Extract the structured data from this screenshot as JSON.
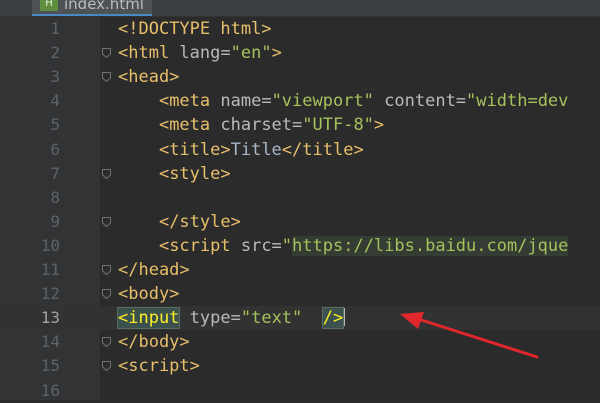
{
  "editor_tab": {
    "icon": "html-file-icon",
    "icon_text": "H",
    "filename": "index.html"
  },
  "colors": {
    "tag": "#e8bf6a",
    "attribute": "#bababa",
    "string": "#a5c25c",
    "text": "#a9b7c6",
    "background": "#2b2b2b",
    "arrow": "#e0282c"
  },
  "current_line": 13,
  "annotation": {
    "type": "red-arrow-pointing-at-line-13"
  },
  "lines": [
    {
      "number": "1",
      "fold": false,
      "tokens": [
        {
          "cls": "tg",
          "text": "<!DOCTYPE html>"
        }
      ]
    },
    {
      "number": "2",
      "fold": true,
      "tokens": [
        {
          "cls": "tg",
          "text": "<html "
        },
        {
          "cls": "at",
          "text": "lang="
        },
        {
          "cls": "st",
          "text": "\"en\""
        },
        {
          "cls": "tg",
          "text": ">"
        }
      ]
    },
    {
      "number": "3",
      "fold": true,
      "tokens": [
        {
          "cls": "tg",
          "text": "<head>"
        }
      ]
    },
    {
      "number": "4",
      "fold": false,
      "tokens": [
        {
          "cls": "tx",
          "text": "    "
        },
        {
          "cls": "tg",
          "text": "<meta "
        },
        {
          "cls": "at",
          "text": "name="
        },
        {
          "cls": "st",
          "text": "\"viewport\" "
        },
        {
          "cls": "at",
          "text": "content="
        },
        {
          "cls": "st",
          "text": "\"width=dev"
        }
      ]
    },
    {
      "number": "5",
      "fold": false,
      "tokens": [
        {
          "cls": "tx",
          "text": "    "
        },
        {
          "cls": "tg",
          "text": "<meta "
        },
        {
          "cls": "at",
          "text": "charset="
        },
        {
          "cls": "st",
          "text": "\"UTF-8\""
        },
        {
          "cls": "tg",
          "text": ">"
        }
      ]
    },
    {
      "number": "6",
      "fold": false,
      "tokens": [
        {
          "cls": "tx",
          "text": "    "
        },
        {
          "cls": "tg",
          "text": "<title>"
        },
        {
          "cls": "tx",
          "text": "Title"
        },
        {
          "cls": "tg",
          "text": "</title>"
        }
      ]
    },
    {
      "number": "7",
      "fold": true,
      "tokens": [
        {
          "cls": "tx",
          "text": "    "
        },
        {
          "cls": "tg",
          "text": "<style>"
        }
      ]
    },
    {
      "number": "8",
      "fold": false,
      "tokens": []
    },
    {
      "number": "9",
      "fold": true,
      "tokens": [
        {
          "cls": "tx",
          "text": "    "
        },
        {
          "cls": "tg",
          "text": "</style>"
        }
      ]
    },
    {
      "number": "10",
      "fold": false,
      "tokens": [
        {
          "cls": "tx",
          "text": "    "
        },
        {
          "cls": "tg",
          "text": "<script "
        },
        {
          "cls": "at",
          "text": "src="
        },
        {
          "cls": "st",
          "text": "\""
        },
        {
          "cls": "url",
          "text": "https://libs.baidu.com/jque"
        }
      ]
    },
    {
      "number": "11",
      "fold": true,
      "tokens": [
        {
          "cls": "tg",
          "text": "</head>"
        }
      ]
    },
    {
      "number": "12",
      "fold": true,
      "tokens": [
        {
          "cls": "tg",
          "text": "<body>"
        }
      ]
    },
    {
      "number": "13",
      "fold": false,
      "tokens": [
        {
          "cls": "bracket-match",
          "text": "<input"
        },
        {
          "cls": "tg",
          "text": " "
        },
        {
          "cls": "at",
          "text": "type="
        },
        {
          "cls": "st",
          "text": "\"text\""
        },
        {
          "cls": "tg",
          "text": "  "
        },
        {
          "cls": "bracket-match",
          "text": "/>"
        },
        {
          "cls": "caret",
          "text": ""
        }
      ]
    },
    {
      "number": "14",
      "fold": true,
      "tokens": [
        {
          "cls": "tg",
          "text": "</body>"
        }
      ]
    },
    {
      "number": "15",
      "fold": true,
      "tokens": [
        {
          "cls": "tg",
          "text": "<script>"
        }
      ]
    },
    {
      "number": "16",
      "fold": false,
      "tokens": []
    }
  ]
}
